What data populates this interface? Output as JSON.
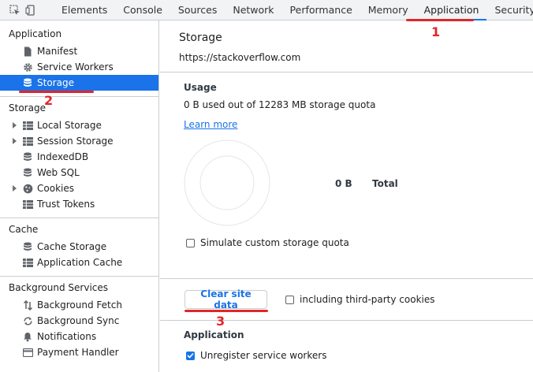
{
  "tabs": [
    {
      "label": "Elements"
    },
    {
      "label": "Console"
    },
    {
      "label": "Sources"
    },
    {
      "label": "Network"
    },
    {
      "label": "Performance"
    },
    {
      "label": "Memory"
    },
    {
      "label": "Application"
    },
    {
      "label": "Security"
    }
  ],
  "active_tab": "Application",
  "sidebar": {
    "application": {
      "title": "Application",
      "items": [
        {
          "label": "Manifest",
          "icon": "file-icon"
        },
        {
          "label": "Service Workers",
          "icon": "gear-icon"
        },
        {
          "label": "Storage",
          "icon": "database-icon",
          "selected": true
        }
      ]
    },
    "storage": {
      "title": "Storage",
      "items": [
        {
          "label": "Local Storage",
          "icon": "grid-icon",
          "expandable": true
        },
        {
          "label": "Session Storage",
          "icon": "grid-icon",
          "expandable": true
        },
        {
          "label": "IndexedDB",
          "icon": "database-icon"
        },
        {
          "label": "Web SQL",
          "icon": "database-icon"
        },
        {
          "label": "Cookies",
          "icon": "cookie-icon",
          "expandable": true
        },
        {
          "label": "Trust Tokens",
          "icon": "grid-icon"
        }
      ]
    },
    "cache": {
      "title": "Cache",
      "items": [
        {
          "label": "Cache Storage",
          "icon": "database-icon"
        },
        {
          "label": "Application Cache",
          "icon": "grid-icon"
        }
      ]
    },
    "background": {
      "title": "Background Services",
      "items": [
        {
          "label": "Background Fetch",
          "icon": "updown-arrows-icon"
        },
        {
          "label": "Background Sync",
          "icon": "sync-icon"
        },
        {
          "label": "Notifications",
          "icon": "bell-icon"
        },
        {
          "label": "Payment Handler",
          "icon": "card-icon"
        }
      ]
    }
  },
  "main": {
    "title": "Storage",
    "origin": "https://stackoverflow.com",
    "usage": {
      "title": "Usage",
      "summary": "0 B used out of 12283 MB storage quota",
      "learn_more": "Learn more",
      "value": "0 B",
      "label": "Total"
    },
    "simulate_quota_label": "Simulate custom storage quota",
    "clear_button": "Clear site data",
    "third_party_label": "including third-party cookies",
    "application": {
      "title": "Application",
      "unregister_label": "Unregister service workers"
    }
  },
  "annotations": [
    "1",
    "2",
    "3"
  ],
  "colors": {
    "accent": "#1a73e8",
    "annotation": "#e0262a",
    "selected_bg": "#1a73e8",
    "border": "#cacdd1"
  }
}
